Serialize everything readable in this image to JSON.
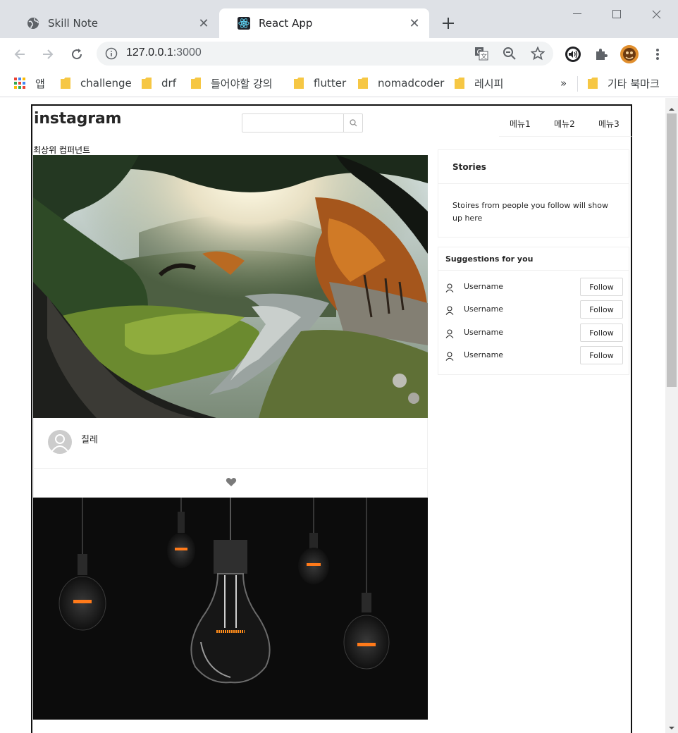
{
  "browser": {
    "tabs": [
      {
        "title": "Skill Note",
        "icon": "globe-icon",
        "active": false
      },
      {
        "title": "React App",
        "icon": "react-icon",
        "active": true
      }
    ],
    "url_host": "127.0.0.1",
    "url_port": ":3000",
    "bookmarks": [
      {
        "label": "앱",
        "icon": "apps-grid-icon"
      },
      {
        "label": "challenge",
        "icon": "folder-icon"
      },
      {
        "label": "drf",
        "icon": "folder-icon"
      },
      {
        "label": "들어야할 강의",
        "icon": "folder-icon"
      },
      {
        "label": "flutter",
        "icon": "folder-icon"
      },
      {
        "label": "nomadcoder",
        "icon": "folder-icon"
      },
      {
        "label": "레시피",
        "icon": "folder-icon"
      }
    ],
    "bookmarks_overflow": "»",
    "other_bookmarks": "기타 북마크"
  },
  "page": {
    "logo": "instagram",
    "search": {
      "placeholder": "",
      "value": ""
    },
    "menu": [
      "메뉴1",
      "메뉴2",
      "메뉴3"
    ],
    "top_component_label": "최상위 컴퍼넌트",
    "posts": [
      {
        "author": "칠레",
        "image": "forest-stream-photo",
        "liked": false
      },
      {
        "author": "",
        "image": "light-bulbs-photo"
      }
    ],
    "stories": {
      "title": "Stories",
      "body": "Stoires from people you follow will show up here"
    },
    "suggestions": {
      "title": "Suggestions for you",
      "users": [
        {
          "name": "Username",
          "button": "Follow"
        },
        {
          "name": "Username",
          "button": "Follow"
        },
        {
          "name": "Username",
          "button": "Follow"
        },
        {
          "name": "Username",
          "button": "Follow"
        }
      ]
    }
  },
  "colors": {
    "tabstrip": "#dee1e6",
    "omnibox": "#f1f3f4",
    "border": "#f0f0f0",
    "text": "#262626"
  }
}
